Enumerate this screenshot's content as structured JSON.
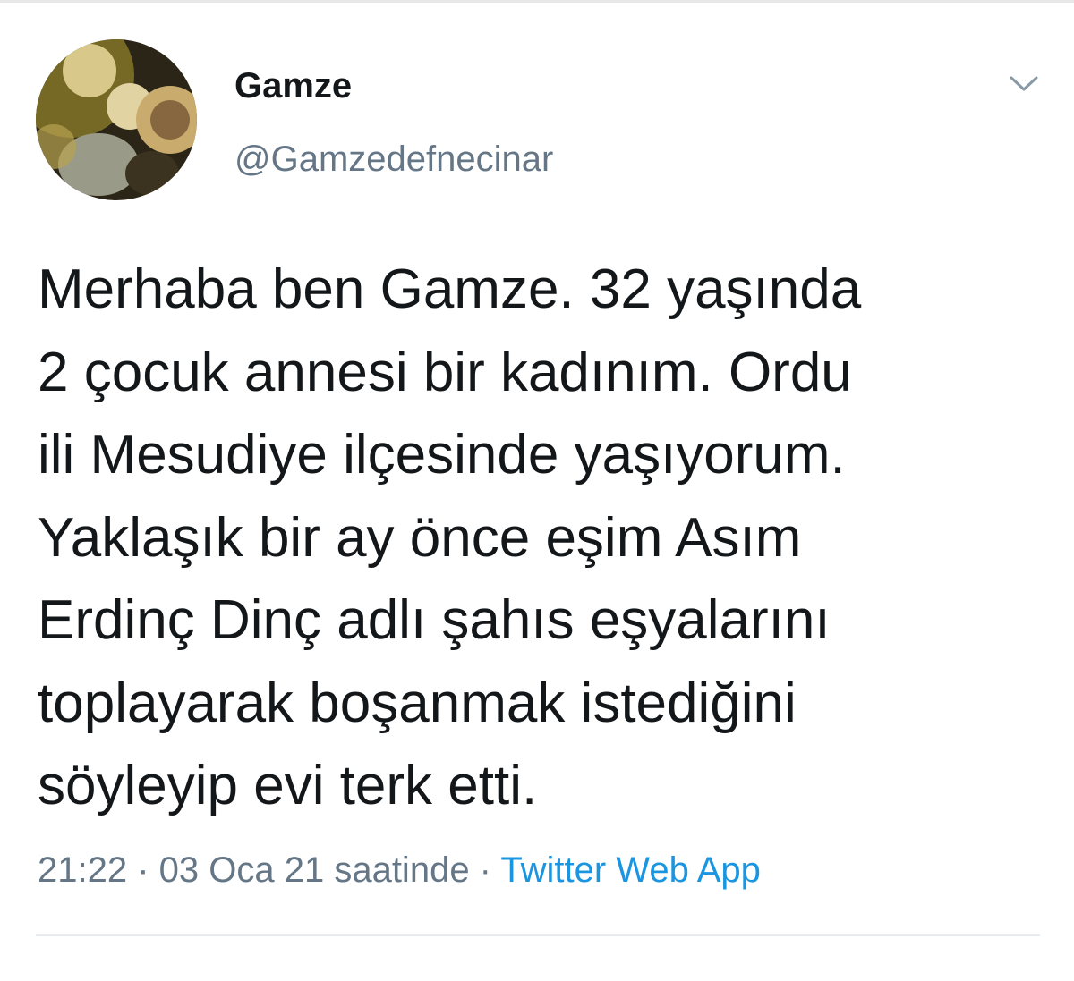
{
  "tweet": {
    "author": {
      "display_name": "Gamze",
      "handle": "@Gamzedefnecinar",
      "avatar_icon": "profile-photo"
    },
    "menu_icon": "chevron-down-icon",
    "text_lines": [
      "Merhaba ben Gamze. 32 yaşında",
      "2 çocuk annesi bir kadınım. Ordu",
      "ili Mesudiye ilçesinde yaşıyorum.",
      "Yaklaşık bir ay önce eşim Asım",
      "Erdinç Dinç adlı şahıs eşyalarını",
      "toplayarak boşanmak istediğini",
      "söyleyip evi terk etti."
    ],
    "timestamp": "21:22 · 03 Oca 21 saatinde",
    "separator": " · ",
    "source": "Twitter Web App"
  },
  "colors": {
    "text": "#14171a",
    "secondary": "#657786",
    "link": "#1b95e0",
    "divider": "#e6ecf0"
  }
}
